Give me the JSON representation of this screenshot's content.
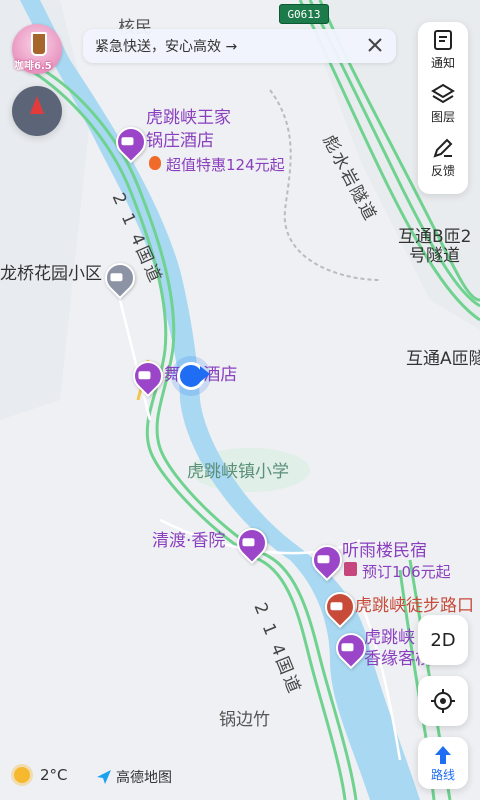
{
  "map": {
    "labels": {
      "village_top": "核民",
      "hotel_wang_line1": "虎跳峡王家",
      "hotel_wang_line2": "锅庄酒店",
      "hotel_wang_deal": "超值特惠124元起",
      "tunnel_biaoshui": "彪水岩隧道",
      "tunnel_b_line1": "互通B匝2",
      "tunnel_b_line2": "号隧道",
      "tunnel_a": "互通A匝隧",
      "road_214_upper": "2 1 4国道",
      "road_214_lower": "2 1 4国道",
      "longqiao": "龙桥花园小区",
      "hotel_center": "舞    大酒店",
      "school": "虎跳峡镇小学",
      "qingdu": "清渡·香院",
      "tingyulou": "听雨楼民宿",
      "tingyulou_deal": "预订106元起",
      "trail_entrance": "虎跳峡徒步路口",
      "xiangyuan_line1": "虎跳峡",
      "xiangyuan_line2": "香缘客栈",
      "guobianzhu": "锅边竹",
      "highway_shield": "G0613"
    }
  },
  "top_left_ad": {
    "text": "咖啡6.5"
  },
  "notice": {
    "text": "紧急快送，安心高效 →"
  },
  "side_panel": {
    "notify": "通知",
    "layers": "图层",
    "feedback": "反馈"
  },
  "controls": {
    "mode_2d": "2D",
    "route": "路线"
  },
  "footer": {
    "temperature": "2°C",
    "brand": "高德地图"
  },
  "colors": {
    "river": "#a8d8f2",
    "highway": "#6fd28f",
    "poi_purple": "#9b46c9",
    "trail_red": "#c84b3a",
    "location_blue": "#1f6df2"
  }
}
